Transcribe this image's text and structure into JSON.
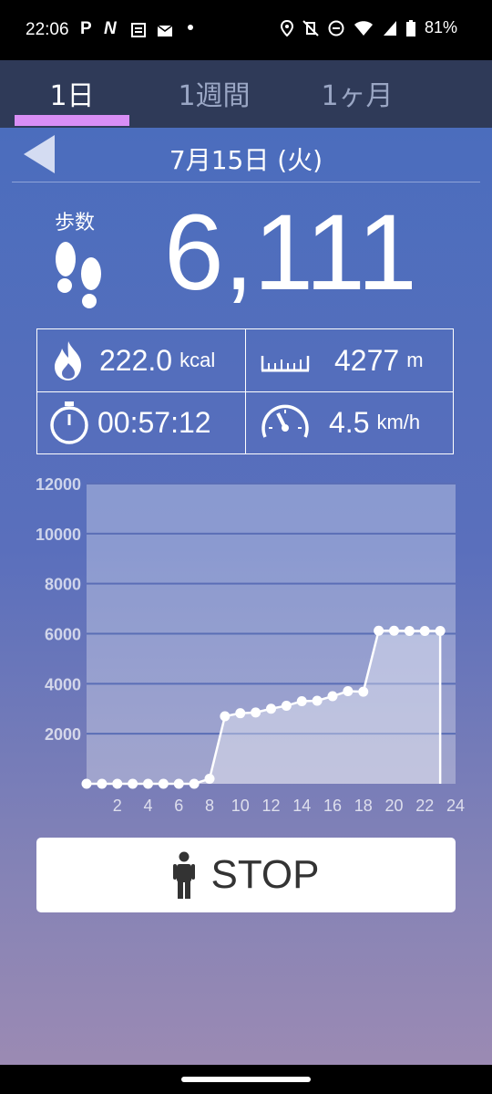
{
  "status_bar": {
    "time": "22:06",
    "notifications": [
      "P",
      "N"
    ],
    "battery": "81%"
  },
  "tabs": [
    {
      "label": "1日",
      "active": true
    },
    {
      "label": "1週間",
      "active": false
    },
    {
      "label": "1ヶ月",
      "active": false
    }
  ],
  "date": "7月15日 (火)",
  "steps": {
    "label": "歩数",
    "value": "6,111"
  },
  "stats": {
    "calories": {
      "value": "222.0",
      "unit": "kcal"
    },
    "distance": {
      "value": "4277",
      "unit": "m"
    },
    "time": {
      "value": "00:57:12"
    },
    "speed": {
      "value": "4.5",
      "unit": "km/h"
    }
  },
  "chart_data": {
    "type": "line",
    "x": [
      0,
      1,
      2,
      3,
      4,
      5,
      6,
      7,
      8,
      9,
      10,
      11,
      12,
      13,
      14,
      15,
      16,
      17,
      18,
      19,
      20,
      21,
      22,
      23
    ],
    "values": [
      0,
      0,
      0,
      0,
      0,
      0,
      0,
      0,
      200,
      2700,
      2820,
      2850,
      3000,
      3120,
      3300,
      3320,
      3500,
      3700,
      3680,
      6120,
      6120,
      6110,
      6110,
      6111
    ],
    "xticks": [
      "2",
      "4",
      "6",
      "8",
      "10",
      "12",
      "14",
      "16",
      "18",
      "20",
      "22",
      "24"
    ],
    "yticks": [
      "2000",
      "4000",
      "6000",
      "8000",
      "10000",
      "12000"
    ],
    "xlim": [
      0,
      24
    ],
    "ylim": [
      0,
      12000
    ],
    "grid": true,
    "title": "",
    "xlabel": "",
    "ylabel": ""
  },
  "stop_button": {
    "label": "STOP"
  },
  "colors": {
    "tab_indicator": "#d98ef5",
    "tab_bar": "#2f3a58"
  }
}
